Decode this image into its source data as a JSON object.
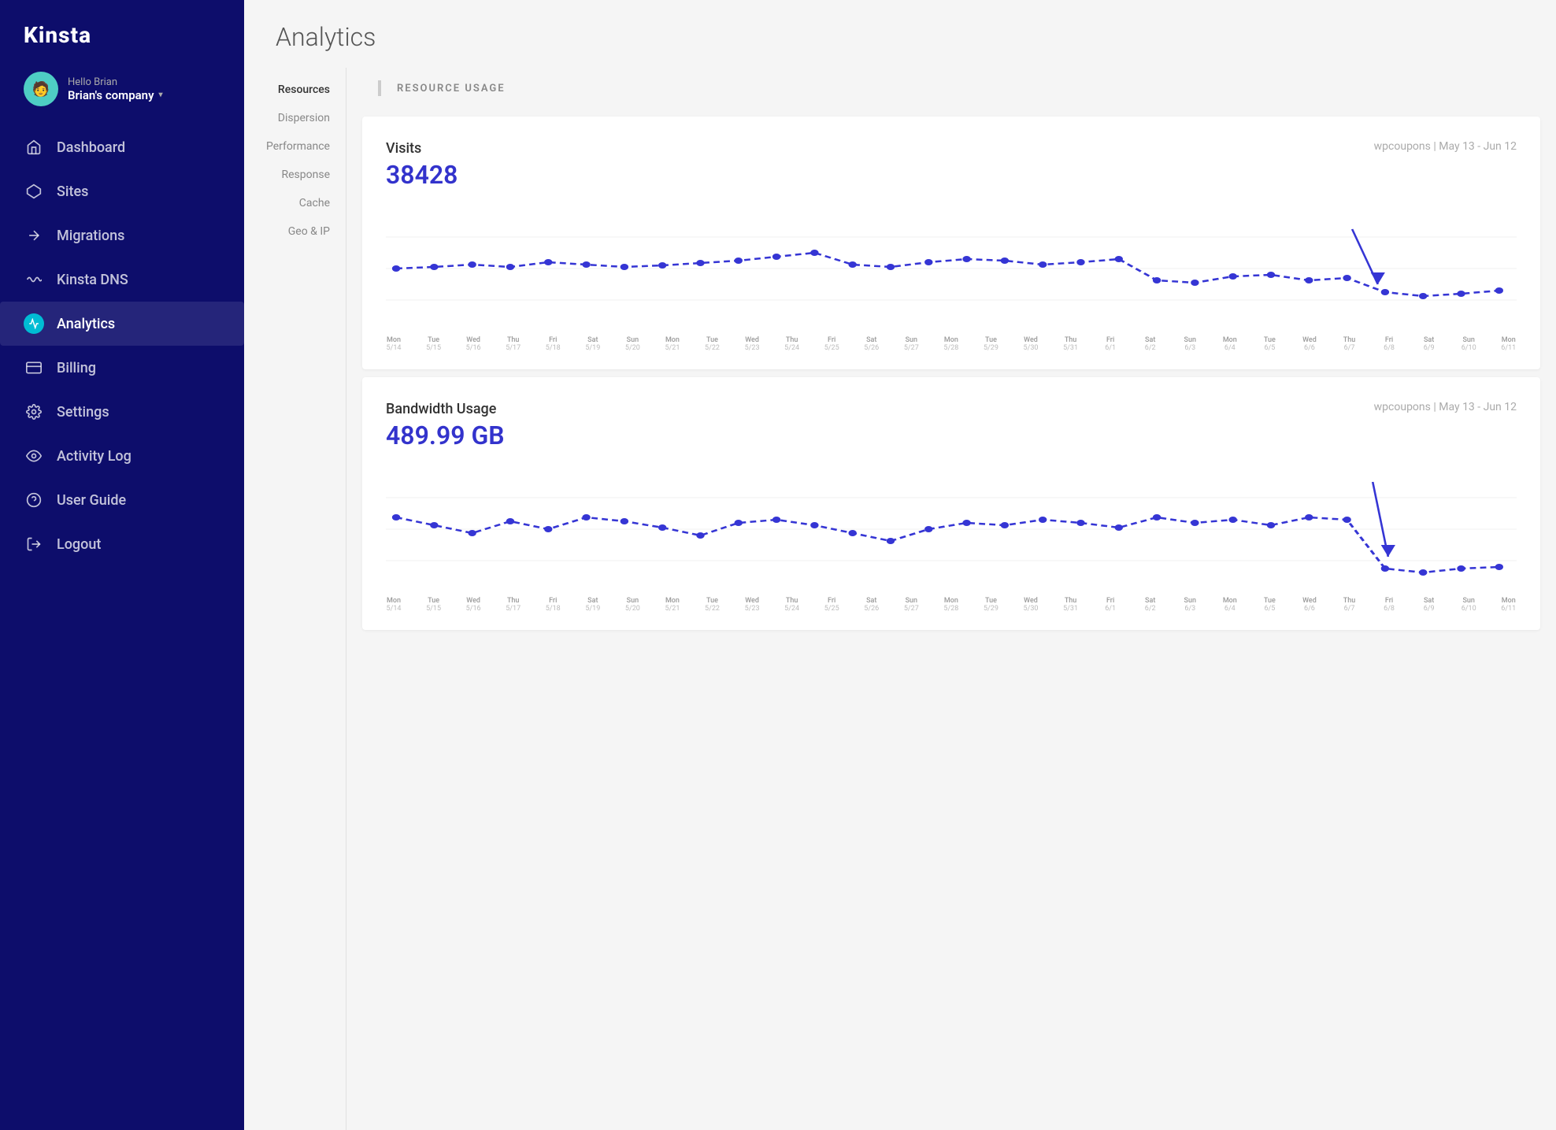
{
  "sidebar": {
    "logo": "Kinsta",
    "user": {
      "hello": "Hello Brian",
      "company": "Brian's company"
    },
    "nav_items": [
      {
        "id": "dashboard",
        "label": "Dashboard",
        "icon": "house"
      },
      {
        "id": "sites",
        "label": "Sites",
        "icon": "diamond"
      },
      {
        "id": "migrations",
        "label": "Migrations",
        "icon": "arrow-right"
      },
      {
        "id": "kinsta-dns",
        "label": "Kinsta DNS",
        "icon": "wave"
      },
      {
        "id": "analytics",
        "label": "Analytics",
        "icon": "chart",
        "active": true
      },
      {
        "id": "billing",
        "label": "Billing",
        "icon": "credit-card"
      },
      {
        "id": "settings",
        "label": "Settings",
        "icon": "gear"
      },
      {
        "id": "activity-log",
        "label": "Activity Log",
        "icon": "eye"
      },
      {
        "id": "user-guide",
        "label": "User Guide",
        "icon": "circle-question"
      },
      {
        "id": "logout",
        "label": "Logout",
        "icon": "logout"
      }
    ]
  },
  "header": {
    "title": "Analytics"
  },
  "sub_nav": {
    "items": [
      {
        "id": "resources",
        "label": "Resources",
        "active": true
      },
      {
        "id": "dispersion",
        "label": "Dispersion"
      },
      {
        "id": "performance",
        "label": "Performance"
      },
      {
        "id": "response",
        "label": "Response"
      },
      {
        "id": "cache",
        "label": "Cache"
      },
      {
        "id": "geo-ip",
        "label": "Geo & IP"
      }
    ]
  },
  "resource_usage_title": "RESOURCE USAGE",
  "charts": [
    {
      "id": "visits",
      "title": "Visits",
      "value": "38428",
      "meta": "wpcoupons | May 13 - Jun 12",
      "color": "#3535d4"
    },
    {
      "id": "bandwidth",
      "title": "Bandwidth Usage",
      "value": "489.99 GB",
      "meta": "wpcoupons | May 13 - Jun 12",
      "color": "#3535d4"
    }
  ],
  "x_axis_labels": [
    {
      "day": "Mon",
      "date": "5/14"
    },
    {
      "day": "Tue",
      "date": "5/15"
    },
    {
      "day": "Wed",
      "date": "5/16"
    },
    {
      "day": "Thu",
      "date": "5/17"
    },
    {
      "day": "Fri",
      "date": "5/18"
    },
    {
      "day": "Sat",
      "date": "5/19"
    },
    {
      "day": "Sun",
      "date": "5/20"
    },
    {
      "day": "Mon",
      "date": "5/21"
    },
    {
      "day": "Tue",
      "date": "5/22"
    },
    {
      "day": "Wed",
      "date": "5/23"
    },
    {
      "day": "Thu",
      "date": "5/24"
    },
    {
      "day": "Fri",
      "date": "5/25"
    },
    {
      "day": "Sat",
      "date": "5/26"
    },
    {
      "day": "Sun",
      "date": "5/27"
    },
    {
      "day": "Mon",
      "date": "5/28"
    },
    {
      "day": "Tue",
      "date": "5/29"
    },
    {
      "day": "Wed",
      "date": "5/30"
    },
    {
      "day": "Thu",
      "date": "5/31"
    },
    {
      "day": "Fri",
      "date": "6/1"
    },
    {
      "day": "Sat",
      "date": "6/2"
    },
    {
      "day": "Sun",
      "date": "6/3"
    },
    {
      "day": "Mon",
      "date": "6/4"
    },
    {
      "day": "Tue",
      "date": "6/5"
    },
    {
      "day": "Wed",
      "date": "6/6"
    },
    {
      "day": "Thu",
      "date": "6/7"
    },
    {
      "day": "Fri",
      "date": "6/8"
    },
    {
      "day": "Sat",
      "date": "6/9"
    },
    {
      "day": "Sun",
      "date": "6/10"
    },
    {
      "day": "Mon",
      "date": "6/11"
    }
  ]
}
